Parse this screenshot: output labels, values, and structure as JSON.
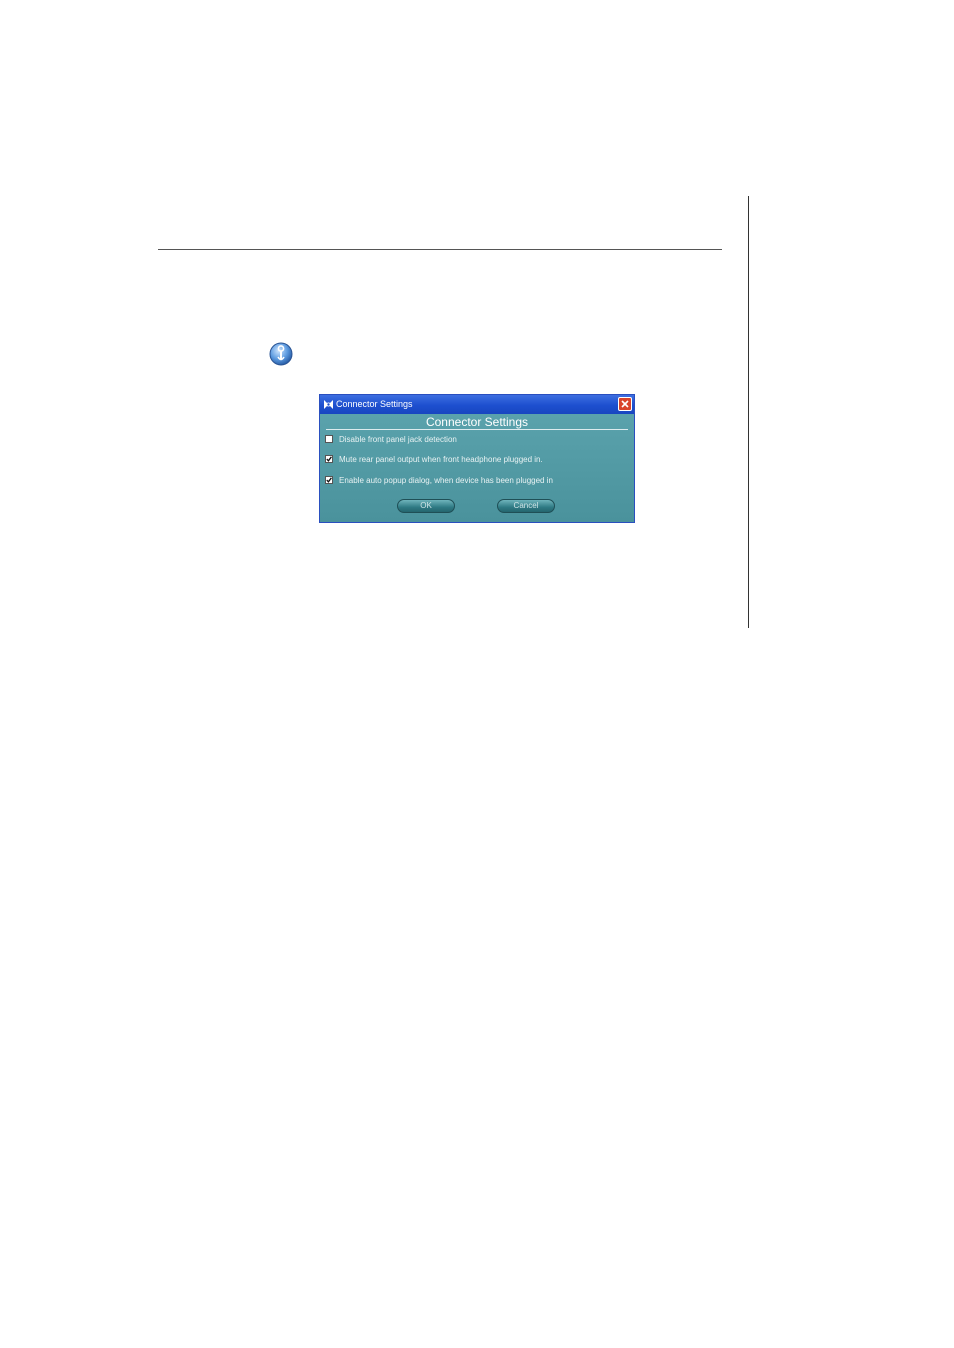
{
  "dialog": {
    "window_title": "Connector Settings",
    "heading": "Connector Settings",
    "options": [
      {
        "label": "Disable front panel jack detection",
        "checked": false
      },
      {
        "label": "Mute rear panel output when front headphone plugged in.",
        "checked": true
      },
      {
        "label": "Enable auto popup dialog, when device has been plugged in",
        "checked": true
      }
    ],
    "ok_label": "OK",
    "cancel_label": "Cancel"
  },
  "icons": {
    "page_icon": "connector-settings-icon",
    "title_icon": "app-logo-icon",
    "close": "close-icon",
    "check": "checkmark-icon"
  },
  "colors": {
    "titlebar": "#1d4fcf",
    "dialog_body": "#4e96a0",
    "close_button": "#d9442b",
    "icon_blue": "#2f6fb8"
  }
}
